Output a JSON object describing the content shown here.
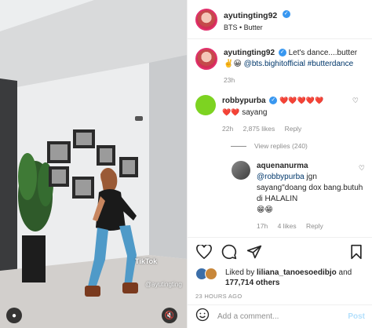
{
  "post_author": {
    "username": "ayutingting92",
    "audio": "BTS • Butter"
  },
  "caption": {
    "username": "ayutingting92",
    "text_1": "Let's dance....butter",
    "emoji": "✌️😀",
    "mentions": "@bts.bighitofficial #butterdance",
    "time": "23h"
  },
  "comment_1": {
    "username": "robbypurba",
    "hearts_line_1": "❤️❤️❤️❤️❤️",
    "hearts_line_2": "❤️❤️",
    "text": "sayang",
    "time": "22h",
    "likes": "2,875 likes",
    "reply_label": "Reply",
    "view_replies": "View replies (240)"
  },
  "reply_1": {
    "username": "aquenanurma",
    "mention": "@robbypurba",
    "text": "jgn sayang\"doang dox bang.butuh di HALALIN",
    "emoji": "😁😁",
    "time": "17h",
    "likes": "4 likes",
    "reply_label": "Reply"
  },
  "likes": {
    "liked_by_prefix": "Liked by",
    "liked_by_user": "liliana_tanoesoedibjo",
    "and": "and",
    "others": "177,714 others"
  },
  "posted_ago": "23 HOURS AGO",
  "add_comment": {
    "placeholder": "Add a comment...",
    "post_label": "Post"
  },
  "video_overlay": {
    "brand": "TikTok",
    "handle": "@ayutingting"
  },
  "colors": {
    "verified": "#3897f0",
    "link": "#00376b",
    "meta": "#8e8e8e",
    "post_disabled": "#b2dffc"
  }
}
